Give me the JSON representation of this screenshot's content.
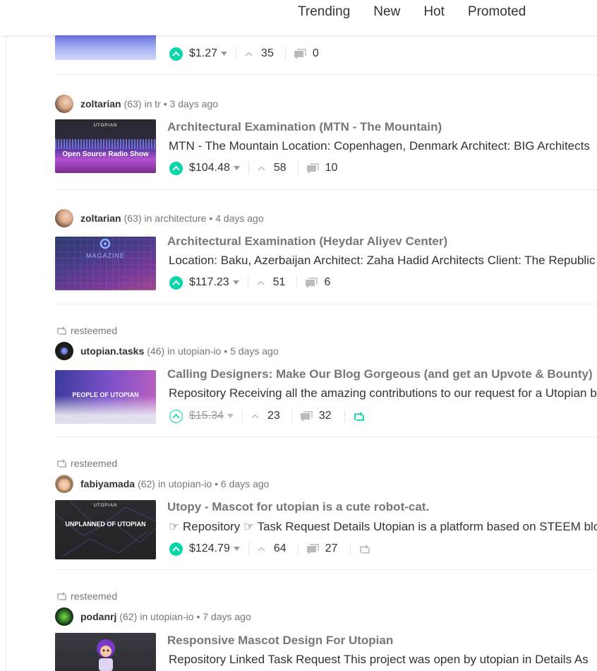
{
  "nav": {
    "tabs": [
      "Trending",
      "New",
      "Hot",
      "Promoted"
    ]
  },
  "posts": [
    {
      "payout": "$1.27",
      "votes": "35",
      "comments": "0",
      "thumb_label": ""
    },
    {
      "author": "zoltarian",
      "reputation": "(63)",
      "in_text": "in",
      "category": "tr",
      "time": "• 3 days ago",
      "title": "Architectural Examination (MTN - The Mountain)",
      "excerpt": "MTN - The Mountain Location: Copenhagen, Denmark Architect: BIG Architects",
      "payout": "$104.48",
      "votes": "58",
      "comments": "10",
      "thumb_brand": "UTOPIAN",
      "thumb_label": "Open Source Radio Show"
    },
    {
      "author": "zoltarian",
      "reputation": "(63)",
      "in_text": "in",
      "category": "architecture",
      "time": "• 4 days ago",
      "title": "Architectural Examination (Heydar Aliyev Center)",
      "excerpt": "Location: Baku, Azerbaijan Architect: Zaha Hadid Architects Client: The Republic of Azerbaijan",
      "payout": "$117.23",
      "votes": "51",
      "comments": "6",
      "thumb_label": "MAGAZINE"
    },
    {
      "resteemed": "resteemed",
      "author": "utopian.tasks",
      "reputation": "(46)",
      "in_text": "in",
      "category": "utopian-io",
      "time": "• 5 days ago",
      "title": "Calling Designers: Make Our Blog Gorgeous (and get an Upvote & Bounty)",
      "excerpt": "Repository Receiving all the amazing contributions to our request for a Utopian blog design",
      "payout": "$15.34",
      "votes": "23",
      "comments": "32",
      "thumb_label": "PEOPLE OF UTOPIAN"
    },
    {
      "resteemed": "resteemed",
      "author": "fabiyamada",
      "reputation": "(62)",
      "in_text": "in",
      "category": "utopian-io",
      "time": "• 6 days ago",
      "title": "Utopy - Mascot for utopian is a cute robot-cat.",
      "excerpt": "☞ Repository ☞ Task Request Details Utopian is a platform based on STEEM blockchain",
      "payout": "$124.79",
      "votes": "64",
      "comments": "27",
      "thumb_brand": "UTOPIAN",
      "thumb_label": "UNPLANNED OF UTOPIAN"
    },
    {
      "resteemed": "resteemed",
      "author": "podanrj",
      "reputation": "(62)",
      "in_text": "in",
      "category": "utopian-io",
      "time": "• 7 days ago",
      "title": "Responsive Mascot Design For Utopian",
      "excerpt": "Repository Linked Task Request This project was open by utopian in Details As"
    }
  ],
  "colors": {
    "accent": "#06d6a9",
    "title": "#777777",
    "text": "#333333"
  }
}
